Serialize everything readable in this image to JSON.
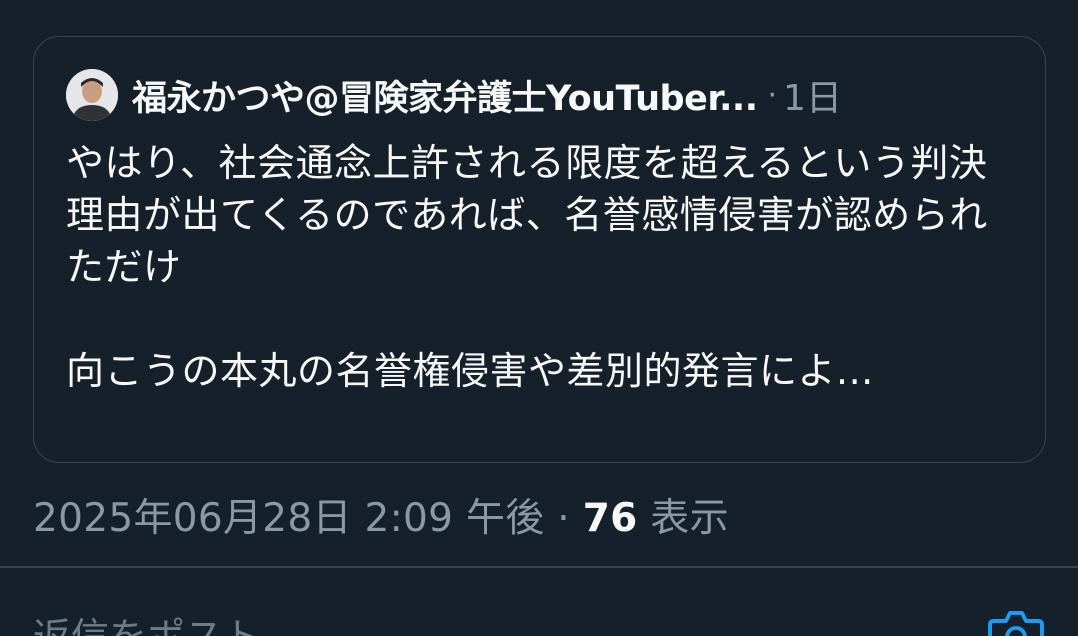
{
  "quoted_post": {
    "author_name": "福永かつや@冒険家弁護士YouTuber...",
    "separator": "·",
    "time": "1日",
    "text": "やはり、社会通念上許される限度を超えるという判決理由が出てくるのであれば、名誉感情侵害が認められただけ\n\n向こうの本丸の名誉権侵害や差別的発言によ..."
  },
  "post_meta": {
    "datetime": "2025年06月28日 2:09 午後",
    "separator": "·",
    "views_count": "76",
    "views_label": "表示"
  },
  "reply": {
    "placeholder": "返信をポスト"
  },
  "icons": {
    "avatar": "author-avatar",
    "camera": "camera-icon"
  },
  "colors": {
    "background": "#15202b",
    "border": "#38444d",
    "text_primary": "#f7f9f9",
    "text_secondary": "#8b98a5",
    "accent": "#1d9bf0"
  }
}
